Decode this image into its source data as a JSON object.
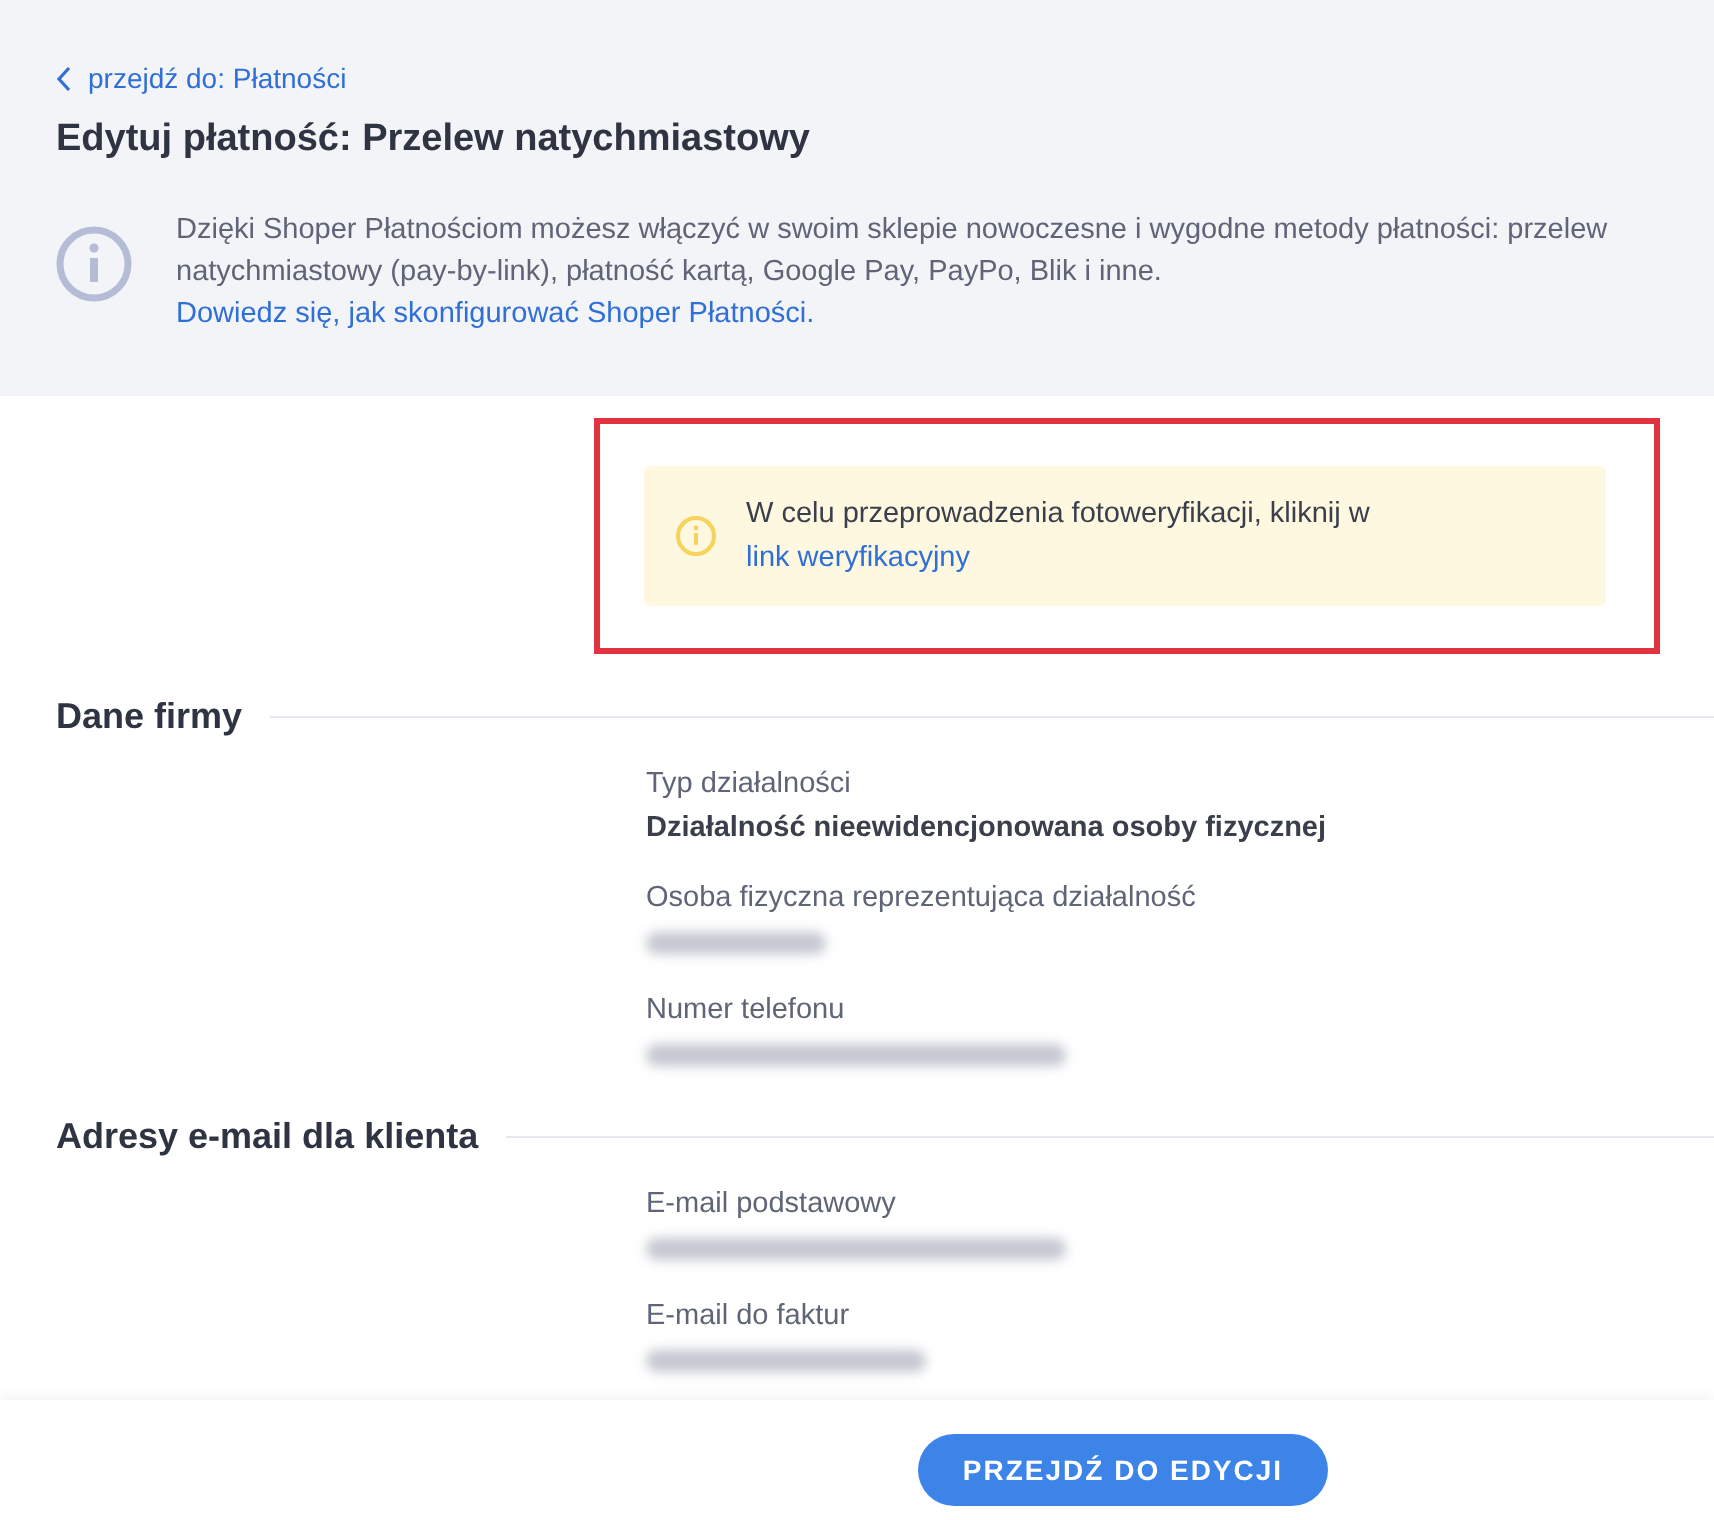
{
  "back_link": {
    "label": "przejdź do: Płatności"
  },
  "title": "Edytuj płatność: Przelew natychmiastowy",
  "info": {
    "text": "Dzięki Shoper Płatnościom możesz włączyć w swoim sklepie nowoczesne i wygodne metody płatności: przelew natychmiastowy (pay-by-link), płatność kartą, Google Pay, PayPo, Blik i inne.",
    "link": "Dowiedz się, jak skonfigurować Shoper Płatności."
  },
  "alert": {
    "highlighted": true,
    "text": "W celu przeprowadzenia fotoweryfikacji, kliknij w ",
    "link": "link weryfikacyjny"
  },
  "sections": [
    {
      "title": "Dane firmy",
      "fields": [
        {
          "label": "Typ działalności",
          "kind": "text",
          "value": "Działalność nieewidencjonowana osoby fizycznej"
        },
        {
          "label": "Osoba fizyczna reprezentująca działalność",
          "kind": "redacted"
        },
        {
          "label": "Numer telefonu",
          "kind": "redacted"
        }
      ]
    },
    {
      "title": "Adresy e-mail dla klienta",
      "fields": [
        {
          "label": "E-mail podstawowy",
          "kind": "redacted"
        },
        {
          "label": "E-mail do faktur",
          "kind": "redacted"
        }
      ]
    }
  ],
  "footer": {
    "button": "PRZEJDŹ DO EDYCJI"
  }
}
